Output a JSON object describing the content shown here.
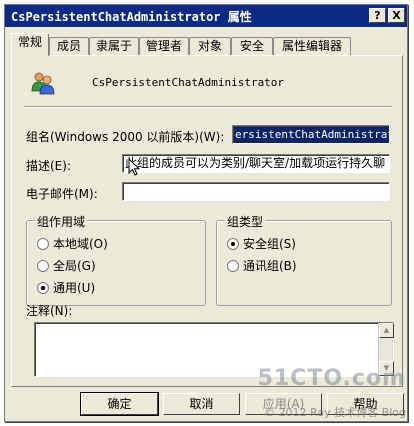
{
  "window": {
    "title": "CsPersistentChatAdministrator 属性",
    "help_button": "?",
    "close_button": "X"
  },
  "tabs": [
    {
      "label": "常规",
      "active": true
    },
    {
      "label": "成员"
    },
    {
      "label": "隶属于"
    },
    {
      "label": "管理者"
    },
    {
      "label": "对象"
    },
    {
      "label": "安全"
    },
    {
      "label": "属性编辑器"
    }
  ],
  "general": {
    "object_name": "CsPersistentChatAdministrator",
    "group_name_label": "组名(Windows 2000 以前版本)(W):",
    "group_name_value": "ersistentChatAdministrator",
    "description_label": "描述(E):",
    "description_value": "此组的成员可以为类别/聊天室/加载项运行持久聊",
    "email_label": "电子邮件(M):",
    "email_value": "",
    "scope": {
      "title": "组作用域",
      "options": [
        {
          "label": "本地域(O)",
          "selected": false
        },
        {
          "label": "全局(G)",
          "selected": false
        },
        {
          "label": "通用(U)",
          "selected": true
        }
      ]
    },
    "type": {
      "title": "组类型",
      "options": [
        {
          "label": "安全组(S)",
          "selected": true
        },
        {
          "label": "通讯组(B)",
          "selected": false
        }
      ]
    },
    "notes_label": "注释(N):",
    "notes_value": ""
  },
  "buttons": {
    "ok": "确定",
    "cancel": "取消",
    "apply": "应用(A)",
    "help": "帮助"
  },
  "watermark": {
    "site": "51CTO.com",
    "credit": "© 2012 Ray 技术博客 Blog"
  }
}
